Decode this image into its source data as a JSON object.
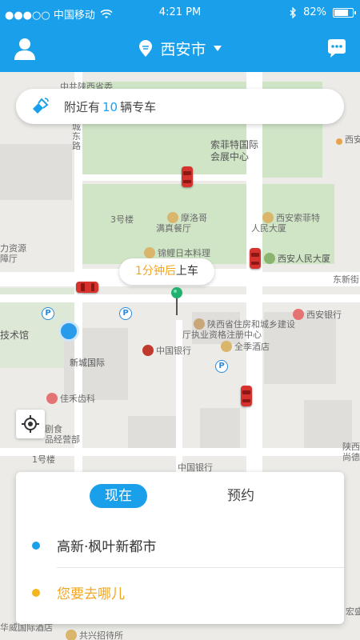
{
  "status_bar": {
    "carrier": "●●●○○ 中国移动",
    "time": "4:21 PM",
    "battery": "82%",
    "battery_level": 0.82
  },
  "header": {
    "city": "西安市"
  },
  "nearby": {
    "prefix": "附近有",
    "count": "10",
    "suffix": "辆专车"
  },
  "pickup": {
    "eta": "1分钟后",
    "action": "上车"
  },
  "map_labels": {
    "street_top": "中共陕西省委",
    "district_east": "城东路",
    "expo": "索菲特国际\n会展中心",
    "xian_ramen": "西安",
    "moroccan": "摩洛哥\n满真餐厅",
    "building3": "3号楼",
    "sofitel": "西安索菲特\n人民大厦",
    "japanese": "锦鲤日本料理",
    "people_mansion": "西安人民大厦",
    "office_west": "力资源\n障厅",
    "dongxin_street": "东新街",
    "tech_museum": "技术馆",
    "housing_dept": "陕西省住房和城乡建设\n厅执业资格注册中心",
    "xian_bank": "西安银行",
    "boc": "中国银行",
    "quanji_hotel": "全季酒店",
    "xincheng": "新城国际",
    "jiahe_dental": "佳禾齿科",
    "hall": "剧食\n品经营部",
    "building1": "1号楼",
    "boc_south": "中国银行",
    "shaanxi_east": "陕西\n尚德",
    "huawei": "华威国际酒店",
    "gongxing": "共兴招待所",
    "hongsheng": "宏盛"
  },
  "panel": {
    "tab_now": "现在",
    "tab_book": "预约",
    "origin": "高新·枫叶新都市",
    "destination_placeholder": "您要去哪儿",
    "origin_color": "#1aa0eb",
    "destination_color": "#f3b61f"
  },
  "colors": {
    "brand": "#1aa0eb",
    "accent": "#f3a622",
    "car": "#d6322e"
  }
}
